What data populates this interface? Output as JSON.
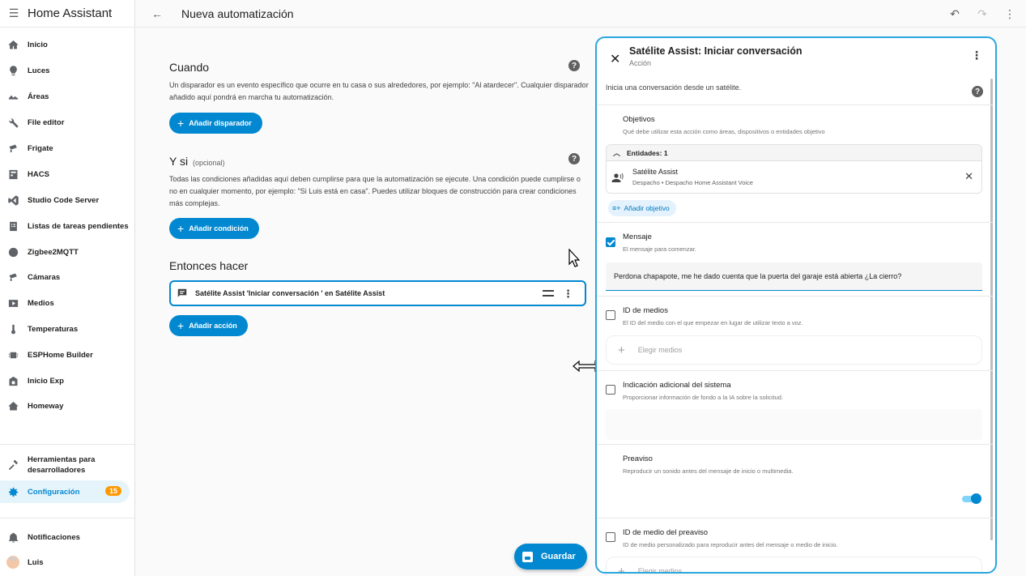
{
  "app": {
    "title": "Home Assistant"
  },
  "sidebar": {
    "items": [
      {
        "label": "Inicio"
      },
      {
        "label": "Luces"
      },
      {
        "label": "Áreas"
      },
      {
        "label": "File editor"
      },
      {
        "label": "Frigate"
      },
      {
        "label": "HACS"
      },
      {
        "label": "Studio Code Server"
      },
      {
        "label": "Listas de tareas pendientes"
      },
      {
        "label": "Zigbee2MQTT"
      },
      {
        "label": "Cámaras"
      },
      {
        "label": "Medios"
      },
      {
        "label": "Temperaturas"
      },
      {
        "label": "ESPHome Builder"
      },
      {
        "label": "Inicio Exp"
      },
      {
        "label": "Homeway"
      }
    ],
    "dev_tools": "Herramientas para desarrolladores",
    "config": {
      "label": "Configuración",
      "badge": "15"
    },
    "notifications": "Notificaciones",
    "user": "Luis"
  },
  "topbar": {
    "title": "Nueva automatización"
  },
  "main": {
    "when": {
      "title": "Cuando",
      "description": "Un disparador es un evento específico que ocurre en tu casa o sus alrededores, por ejemplo: \"Al atardecer\". Cualquier disparador añadido aquí pondrá en marcha tu automatización.",
      "button": "Añadir disparador"
    },
    "if": {
      "title": "Y si",
      "optional": "(opcional)",
      "description": "Todas las condiciones añadidas aquí deben cumplirse para que la automatización se ejecute. Una condición puede cumplirse o no en cualquier momento, por ejemplo: \"Si Luis está en casa\". Puedes utilizar bloques de construcción para crear condiciones más complejas.",
      "button": "Añadir condición"
    },
    "then": {
      "title": "Entonces hacer",
      "action_text": "Satélite Assist 'Iniciar conversación ' en Satélite Assist",
      "button": "Añadir acción"
    },
    "save": "Guardar"
  },
  "panel": {
    "title": "Satélite Assist: Iniciar conversación",
    "subtitle": "Acción",
    "description": "Inicia una conversación desde un satélite.",
    "targets": {
      "label": "Objetivos",
      "desc": "Qué debe utilizar esta acción como áreas, dispositivos o entidades objetivo",
      "entities_header": "Entidades: 1",
      "entity_name": "Satélite Assist",
      "entity_path": "Despacho  •  Despacho Home Assistant Voice",
      "add_target": "Añadir objetivo"
    },
    "message": {
      "label": "Mensaje",
      "desc": "El mensaje para comenzar.",
      "value": "Perdona chapapote, me he dado cuenta que la puerta del garaje está abierta ¿La cierro?"
    },
    "media_id": {
      "label": "ID de medios",
      "desc": "El ID del medio con el que empezar en lugar de utilizar texto a voz.",
      "placeholder": "Elegir medios"
    },
    "extra_system_prompt": {
      "label": "Indicación adicional del sistema",
      "desc": "Proporcionar información de fondo a la IA sobre la solicitud."
    },
    "preannounce": {
      "label": "Preaviso",
      "desc": "Reproducir un sonido antes del mensaje de inicio o multimedia."
    },
    "preannounce_media": {
      "label": "ID de medio del preaviso",
      "desc": "ID de medio personalizado para reproducir antes del mensaje o medio de inicio.",
      "placeholder": "Elegir medios"
    }
  }
}
